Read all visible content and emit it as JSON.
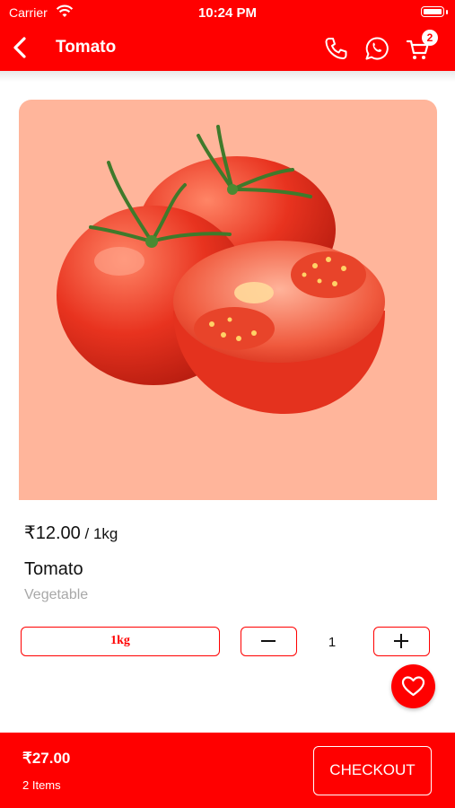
{
  "status_bar": {
    "carrier": "Carrier",
    "time": "10:24 PM"
  },
  "header": {
    "title": "Tomato",
    "cart_count": "2"
  },
  "product": {
    "price": "₹12.00",
    "price_unit": " / 1kg",
    "name": "Tomato",
    "category": "Vegetable",
    "selected_variant": "1kg",
    "quantity": "1"
  },
  "footer": {
    "total": "₹27.00",
    "items": "2 Items",
    "checkout_label": "CHECKOUT"
  },
  "colors": {
    "brand": "#ff0000",
    "image_bg": "#ffb59b",
    "muted_text": "#a8a8a8"
  }
}
